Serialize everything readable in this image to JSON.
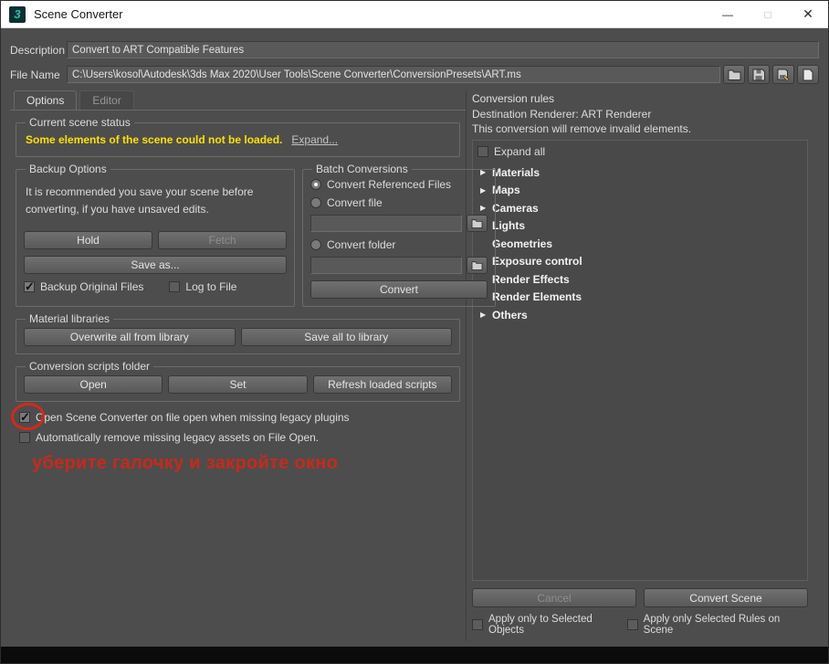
{
  "colors": {
    "warning_yellow": "#ffe100",
    "annotation_red": "#c8291b",
    "app_icon_teal": "#1fc3ad"
  },
  "window": {
    "title": "Scene Converter",
    "app_icon_glyph": "3",
    "minimize_glyph": "—",
    "maximize_glyph": "□",
    "close_glyph": "✕"
  },
  "header": {
    "description_label": "Description",
    "description_value": "Convert to ART Compatible Features",
    "file_name_label": "File Name",
    "file_name_value": "C:\\Users\\kosol\\Autodesk\\3ds Max 2020\\User Tools\\Scene Converter\\ConversionPresets\\ART.ms"
  },
  "tabs": {
    "options": "Options",
    "editor": "Editor"
  },
  "scene_status": {
    "group_title": "Current scene status",
    "warning": "Some elements of the scene could not be loaded.",
    "expand_link": "Expand..."
  },
  "backup": {
    "group_title": "Backup Options",
    "note": "It is recommended you save your scene before converting, if you have unsaved edits.",
    "hold_button": "Hold",
    "fetch_button": "Fetch",
    "save_as_button": "Save as...",
    "backup_original_label": "Backup Original Files",
    "log_to_file_label": "Log to File"
  },
  "batch": {
    "group_title": "Batch Conversions",
    "convert_referenced_label": "Convert Referenced Files",
    "convert_file_label": "Convert file",
    "file_path_value": "",
    "convert_folder_label": "Convert folder",
    "folder_path_value": "",
    "convert_button": "Convert"
  },
  "material_libraries": {
    "group_title": "Material libraries",
    "overwrite_button": "Overwrite all from library",
    "save_all_button": "Save all to library"
  },
  "scripts": {
    "group_title": "Conversion scripts folder",
    "open_button": "Open",
    "set_button": "Set",
    "refresh_button": "Refresh loaded scripts"
  },
  "footer_options": {
    "open_on_missing_label": "Open Scene Converter on file open when missing legacy plugins",
    "auto_remove_label": "Automatically remove missing legacy assets on File Open."
  },
  "annotation": {
    "text": "уберите галочку и закройте окно"
  },
  "rules": {
    "title": "Conversion rules",
    "destination": "Destination Renderer: ART Renderer",
    "note": "This conversion will remove invalid elements.",
    "expand_all_label": "Expand all",
    "items": [
      {
        "label": "Materials",
        "arrow": "▶"
      },
      {
        "label": "Maps",
        "arrow": "▶"
      },
      {
        "label": "Cameras",
        "arrow": "▶"
      },
      {
        "label": "Lights",
        "arrow": "▶"
      },
      {
        "label": "Geometries",
        "arrow": ""
      },
      {
        "label": "Exposure control",
        "arrow": "▶"
      },
      {
        "label": "Render Effects",
        "arrow": ""
      },
      {
        "label": "Render Elements",
        "arrow": ""
      },
      {
        "label": "Others",
        "arrow": "▶"
      }
    ],
    "cancel_button": "Cancel",
    "convert_scene_button": "Convert Scene",
    "apply_selected_objects_label": "Apply only to Selected Objects",
    "apply_selected_rules_label": "Apply only Selected Rules on Scene"
  }
}
